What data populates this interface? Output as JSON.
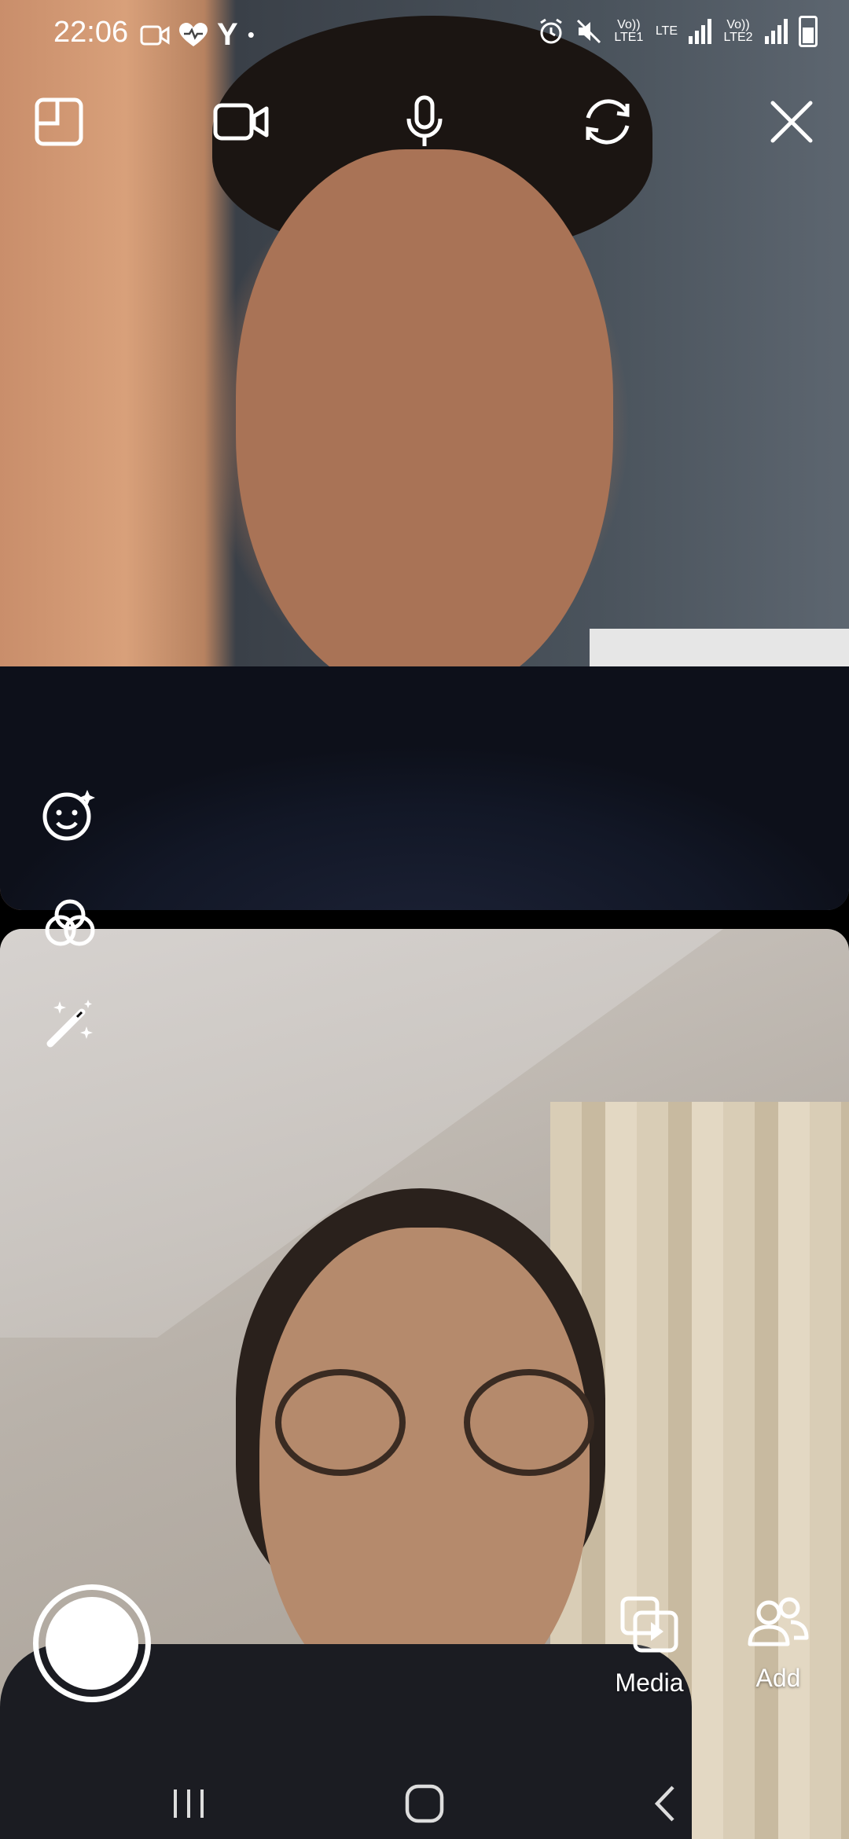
{
  "status_bar": {
    "time": "22:06",
    "network_labels": [
      "Vo)) LTE1",
      "LTE",
      "Vo)) LTE2"
    ],
    "left_icons": [
      "video-call-icon",
      "heart-health-icon",
      "y-app-icon",
      "dot-icon"
    ],
    "right_icons": [
      "alarm-icon",
      "mute-icon",
      "signal-icon",
      "battery-icon"
    ]
  },
  "top_controls": [
    "layout-icon",
    "video-toggle-icon",
    "mic-icon",
    "switch-camera-icon",
    "close-icon"
  ],
  "side_tools": [
    "face-effects-icon",
    "filters-icon",
    "magic-wand-icon"
  ],
  "bottom_actions": {
    "media_label": "Media",
    "add_label": "Add"
  },
  "nav": [
    "recents-icon",
    "home-icon",
    "back-icon"
  ]
}
